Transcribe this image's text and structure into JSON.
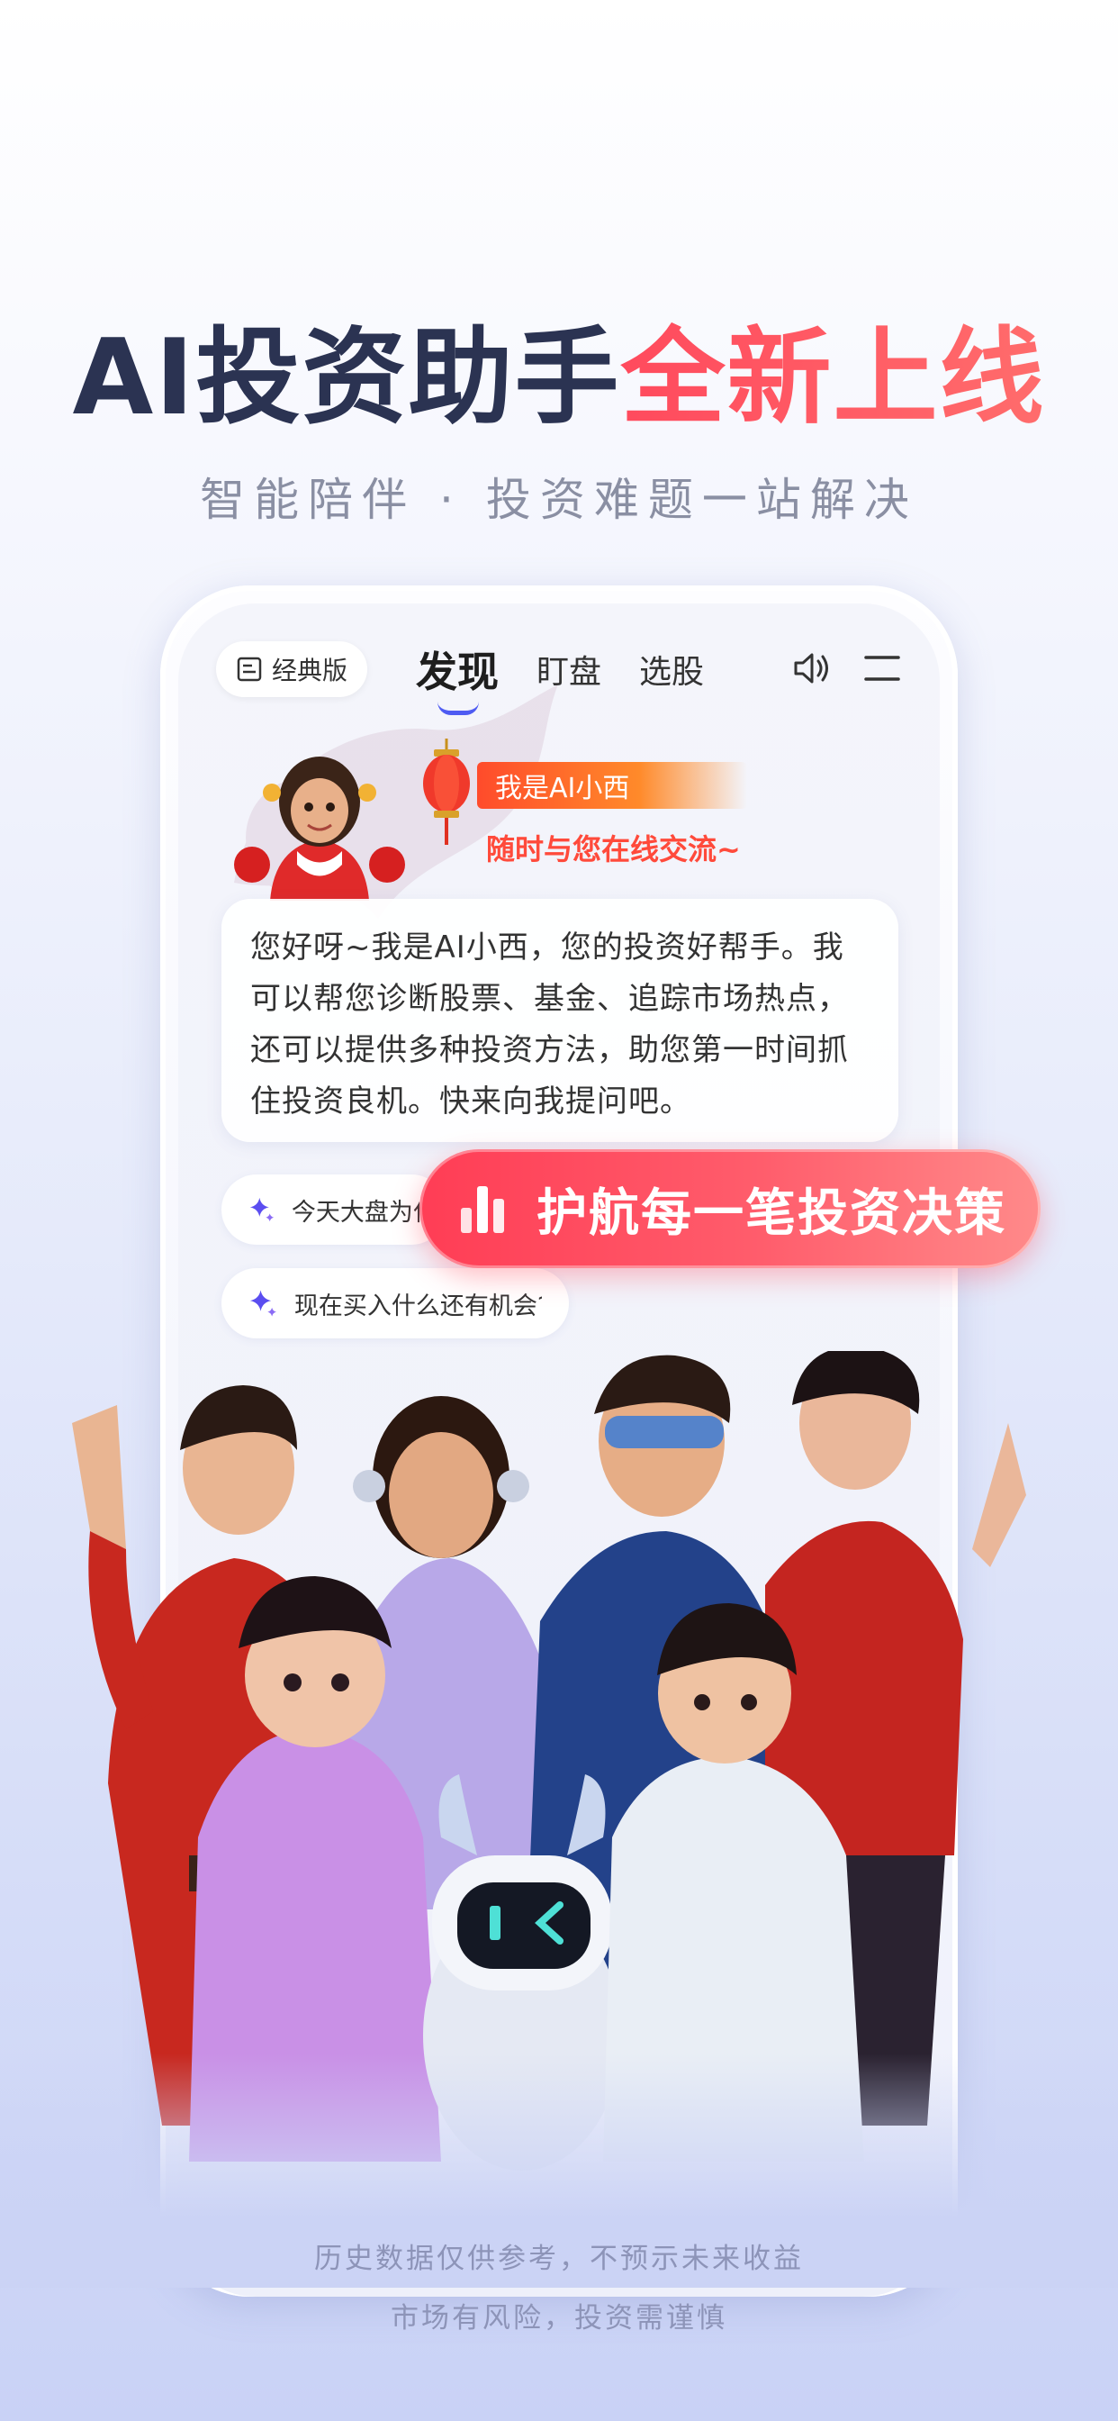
{
  "headline": {
    "part1": "AI投资助手",
    "part2": "全新上线"
  },
  "subhead": "智能陪伴 · 投资难题一站解决",
  "app": {
    "classic_label": "经典版",
    "tabs": [
      {
        "label": "发现",
        "active": true
      },
      {
        "label": "盯盘",
        "active": false
      },
      {
        "label": "选股",
        "active": false
      }
    ],
    "icons": {
      "classic": "document-icon",
      "sound": "speaker-icon",
      "menu": "menu-icon"
    },
    "ai_banner": {
      "title": "我是AI小西",
      "slogan": "随时与您在线交流~"
    },
    "chat_message": "您好呀~我是AI小西，您的投资好帮手。我可以帮您诊断股票、基金、追踪市场热点，还可以提供多种投资方法，助您第一时间抓住投资良机。快来向我提问吧。",
    "suggestions": [
      {
        "text": "今天大盘为什",
        "icon": "sparkle-icon"
      },
      {
        "text": "现在买入什么还有机会?",
        "icon": "sparkle-icon"
      }
    ]
  },
  "cta": {
    "label": "护航每一笔投资决策",
    "icon": "bar-chart-icon"
  },
  "disclaimer": {
    "line1": "历史数据仅供参考，不预示未来收益",
    "line2": "市场有风险，投资需谨慎"
  },
  "colors": {
    "accent_red": "#ff4a5d",
    "title_dark": "#2b3352",
    "tab_indicator": "#4e5bf2",
    "sparkle": "#5b4ef0"
  }
}
